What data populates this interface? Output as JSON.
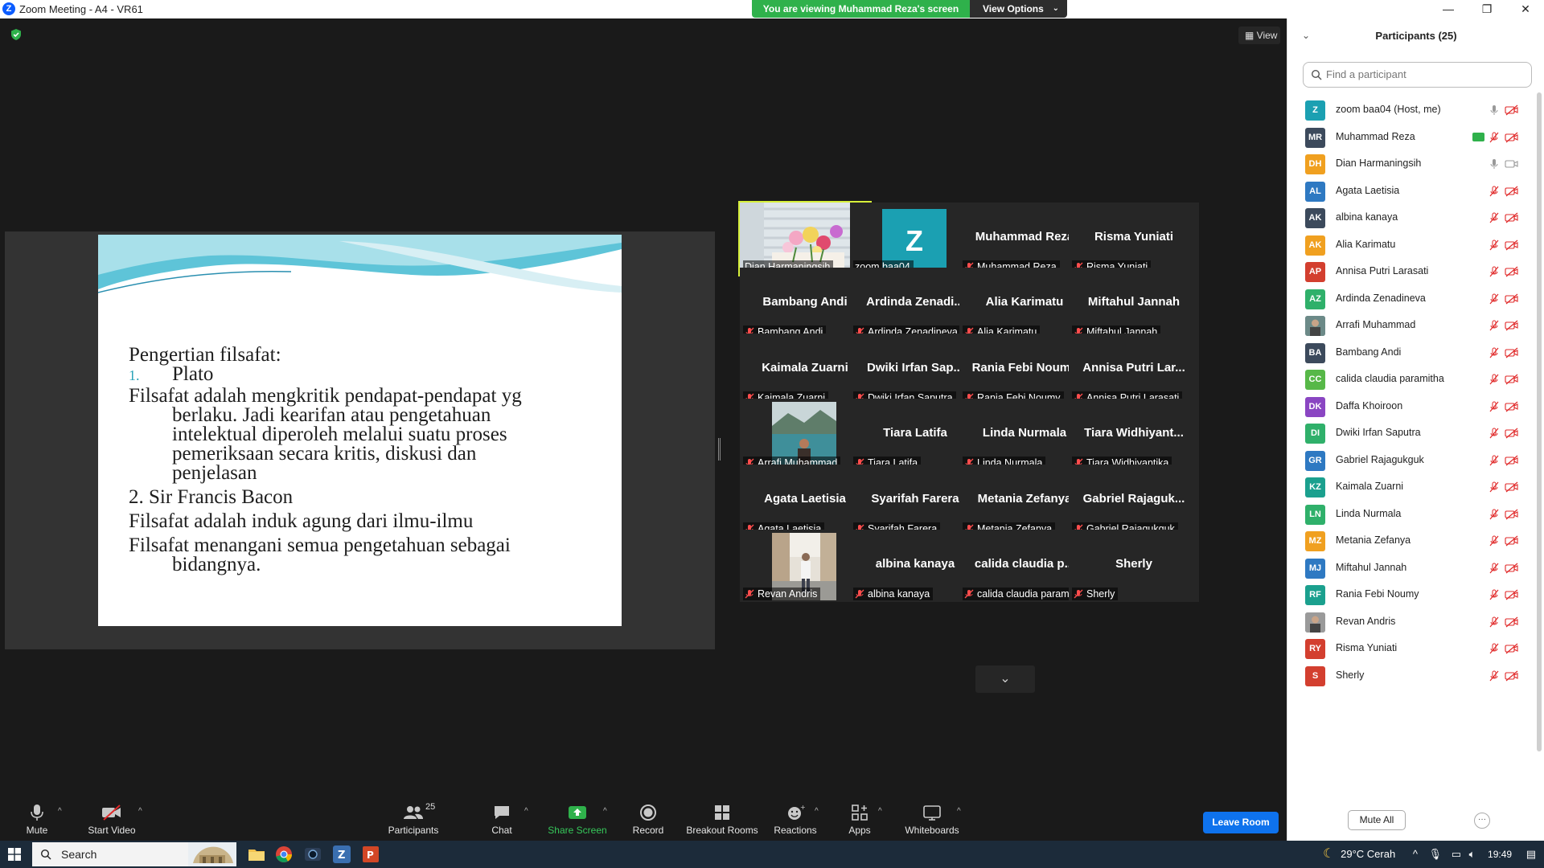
{
  "window": {
    "title": "Zoom Meeting - A4 - VR61",
    "logo_letter": "Z"
  },
  "banner": {
    "viewing_text": "You are viewing Muhammad Reza's screen",
    "options_label": "View Options"
  },
  "view_button": {
    "label": "View"
  },
  "slide": {
    "line1": "Pengertian filsafat:",
    "item1_num": "1.",
    "item1_text": "Plato",
    "def1_a": "Filsafat adalah mengkritik pendapat-pendapat yg",
    "def1_b": "berlaku. Jadi kearifan atau pengetahuan",
    "def1_c": "intelektual diperoleh melalui suatu proses",
    "def1_d": "pemeriksaan secara kritis, diskusi dan",
    "def1_e": "penjelasan",
    "item2": "2. Sir Francis Bacon",
    "def2": "Filsafat adalah induk agung dari ilmu-ilmu",
    "def3_a": "Filsafat menangani semua pengetahuan sebagai",
    "def3_b": "bidangnya."
  },
  "gallery": {
    "tiles": [
      {
        "big": "",
        "label": "Dian Harmaningsih",
        "muted": false,
        "kind": "flowers",
        "active": true
      },
      {
        "big": "Z",
        "label": "zoom baa04",
        "muted": false,
        "kind": "z"
      },
      {
        "big": "Muhammad Reza",
        "label": "Muhammad Reza",
        "muted": true
      },
      {
        "big": "Risma Yuniati",
        "label": "Risma Yuniati",
        "muted": true
      },
      {
        "big": "Bambang Andi",
        "label": "Bambang Andi",
        "muted": true
      },
      {
        "big": "Ardinda  Zenadi...",
        "label": "Ardinda Zenadineva",
        "muted": true
      },
      {
        "big": "Alia Karimatu",
        "label": "Alia Karimatu",
        "muted": true
      },
      {
        "big": "Miftahul Jannah",
        "label": "Miftahul Jannah",
        "muted": true
      },
      {
        "big": "Kaimala Zuarni",
        "label": "Kaimala Zuarni",
        "muted": true
      },
      {
        "big": "Dwiki  Irfan  Sap...",
        "label": "Dwiki Irfan Saputra",
        "muted": true
      },
      {
        "big": "Rania Febi Noumy",
        "label": "Rania Febi Noumy",
        "muted": true
      },
      {
        "big": "Annisa  Putri  Lar...",
        "label": "Annisa Putri Larasati",
        "muted": true
      },
      {
        "big": "",
        "label": "Arrafi Muhammad",
        "muted": true,
        "kind": "lake"
      },
      {
        "big": "Tiara Latifa",
        "label": "Tiara Latifa",
        "muted": true
      },
      {
        "big": "Linda Nurmala",
        "label": "Linda Nurmala",
        "muted": true
      },
      {
        "big": "Tiara  Widhiyant...",
        "label": "Tiara Widhiyantika",
        "muted": true
      },
      {
        "big": "Agata Laetisia",
        "label": "Agata Laetisia",
        "muted": true
      },
      {
        "big": "Syarifah Farera",
        "label": "Syarifah Farera",
        "muted": true
      },
      {
        "big": "Metania Zefanya",
        "label": "Metania Zefanya",
        "muted": true
      },
      {
        "big": "Gabriel  Rajaguk...",
        "label": "Gabriel Rajagukguk",
        "muted": true
      },
      {
        "big": "",
        "label": "Revan Andris",
        "muted": true,
        "kind": "street"
      },
      {
        "big": "albina kanaya",
        "label": "albina kanaya",
        "muted": true
      },
      {
        "big": "calida  claudia  p...",
        "label": "calida claudia parami...",
        "muted": true
      },
      {
        "big": "Sherly",
        "label": "Sherly",
        "muted": true
      }
    ]
  },
  "toolbar": {
    "mute": "Mute",
    "start_video": "Start Video",
    "participants": "Participants",
    "participants_count": "25",
    "chat": "Chat",
    "share_screen": "Share Screen",
    "record": "Record",
    "breakout_rooms": "Breakout Rooms",
    "reactions": "Reactions",
    "apps": "Apps",
    "whiteboards": "Whiteboards",
    "leave_room": "Leave Room"
  },
  "panel": {
    "title": "Participants (25)",
    "search_placeholder": "Find a participant",
    "mute_all": "Mute All",
    "more": "···",
    "participants": [
      {
        "initials": "Z",
        "name": "zoom baa04 (Host, me)",
        "color": "#1ba0b2",
        "mic": "on",
        "cam": "off"
      },
      {
        "initials": "MR",
        "name": "Muhammad Reza",
        "color": "#3c4a5c",
        "mic": "off",
        "cam": "off",
        "sharing": true
      },
      {
        "initials": "DH",
        "name": "Dian Harmaningsih",
        "color": "#f0a020",
        "mic": "on",
        "cam": "on"
      },
      {
        "initials": "AL",
        "name": "Agata Laetisia",
        "color": "#2e79c2",
        "mic": "off",
        "cam": "off"
      },
      {
        "initials": "AK",
        "name": "albina kanaya",
        "color": "#3c4a5c",
        "mic": "off",
        "cam": "off"
      },
      {
        "initials": "AK",
        "name": "Alia Karimatu",
        "color": "#f0a020",
        "mic": "off",
        "cam": "off"
      },
      {
        "initials": "AP",
        "name": "Annisa Putri Larasati",
        "color": "#d33f2f",
        "mic": "off",
        "cam": "off"
      },
      {
        "initials": "AZ",
        "name": "Ardinda Zenadineva",
        "color": "#2fb06a",
        "mic": "off",
        "cam": "off"
      },
      {
        "initials": "",
        "name": "Arrafi Muhammad",
        "color": "#6c8a88",
        "mic": "off",
        "cam": "off",
        "photo": true
      },
      {
        "initials": "BA",
        "name": "Bambang Andi",
        "color": "#3c4a5c",
        "mic": "off",
        "cam": "off"
      },
      {
        "initials": "CC",
        "name": "calida claudia paramitha",
        "color": "#57b848",
        "mic": "off",
        "cam": "off"
      },
      {
        "initials": "DK",
        "name": "Daffa Khoiroon",
        "color": "#8a46c2",
        "mic": "off",
        "cam": "off"
      },
      {
        "initials": "DI",
        "name": "Dwiki Irfan Saputra",
        "color": "#2fb06a",
        "mic": "off",
        "cam": "off"
      },
      {
        "initials": "GR",
        "name": "Gabriel Rajagukguk",
        "color": "#2e79c2",
        "mic": "off",
        "cam": "off"
      },
      {
        "initials": "KZ",
        "name": "Kaimala Zuarni",
        "color": "#1ba08e",
        "mic": "off",
        "cam": "off"
      },
      {
        "initials": "LN",
        "name": "Linda Nurmala",
        "color": "#2fb06a",
        "mic": "off",
        "cam": "off"
      },
      {
        "initials": "MZ",
        "name": "Metania Zefanya",
        "color": "#f0a020",
        "mic": "off",
        "cam": "off"
      },
      {
        "initials": "MJ",
        "name": "Miftahul Jannah",
        "color": "#2e79c2",
        "mic": "off",
        "cam": "off"
      },
      {
        "initials": "RF",
        "name": "Rania Febi Noumy",
        "color": "#1ba08e",
        "mic": "off",
        "cam": "off"
      },
      {
        "initials": "",
        "name": "Revan Andris",
        "color": "#9a9a9a",
        "mic": "off",
        "cam": "off",
        "photo": true
      },
      {
        "initials": "RY",
        "name": "Risma Yuniati",
        "color": "#d33f2f",
        "mic": "off",
        "cam": "off"
      },
      {
        "initials": "S",
        "name": "Sherly",
        "color": "#d33f2f",
        "mic": "off",
        "cam": "off"
      }
    ]
  },
  "taskbar": {
    "search": "Search",
    "weather": "29°C  Cerah",
    "time": "19:49"
  }
}
